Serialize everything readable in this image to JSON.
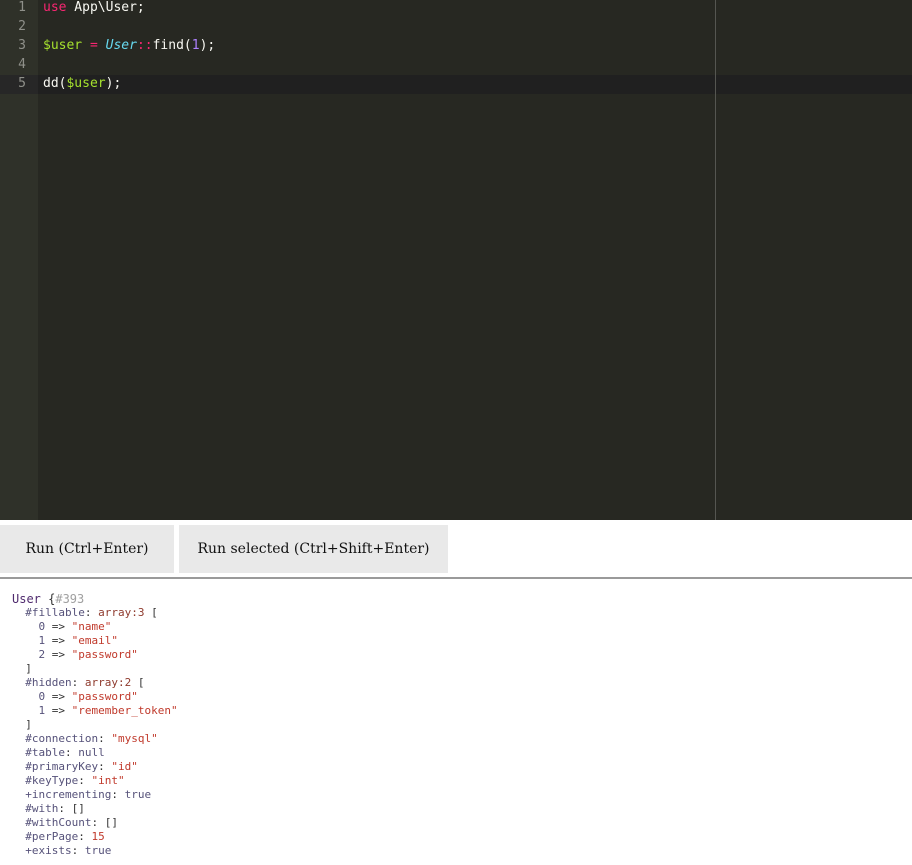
{
  "editor": {
    "line_numbers": [
      "1",
      "2",
      "3",
      "4",
      "5"
    ],
    "line1": {
      "kw": "use",
      "rest": " App\\User;"
    },
    "line3": {
      "var": "$user",
      "eq": " = ",
      "cls": "User",
      "sep": "::",
      "call": "find(",
      "num": "1",
      "end": ");"
    },
    "line5": {
      "fn": "dd(",
      "var": "$user",
      "end": ");"
    }
  },
  "buttons": {
    "run_label": "Run (Ctrl+Enter)",
    "run_selected_label": "Run selected (Ctrl+Shift+Enter)"
  },
  "output": {
    "class_name": "User",
    "open_brace": " {",
    "object_id": "#393",
    "fillable": {
      "key": "#fillable",
      "type": "array:3",
      "items": [
        {
          "index": "0",
          "value": "\"name\""
        },
        {
          "index": "1",
          "value": "\"email\""
        },
        {
          "index": "2",
          "value": "\"password\""
        }
      ]
    },
    "hidden": {
      "key": "#hidden",
      "type": "array:2",
      "items": [
        {
          "index": "0",
          "value": "\"password\""
        },
        {
          "index": "1",
          "value": "\"remember_token\""
        }
      ]
    },
    "connection": {
      "key": "#connection",
      "value": "\"mysql\""
    },
    "table": {
      "key": "#table",
      "value": "null"
    },
    "primaryKey": {
      "key": "#primaryKey",
      "value": "\"id\""
    },
    "keyType": {
      "key": "#keyType",
      "value": "\"int\""
    },
    "incrementing": {
      "key": "+incrementing",
      "value": "true"
    },
    "with": {
      "key": "#with",
      "value": "[]"
    },
    "withCount": {
      "key": "#withCount",
      "value": "[]"
    },
    "perPage": {
      "key": "#perPage",
      "value": "15"
    },
    "exists": {
      "key": "+exists",
      "value": "true"
    }
  }
}
